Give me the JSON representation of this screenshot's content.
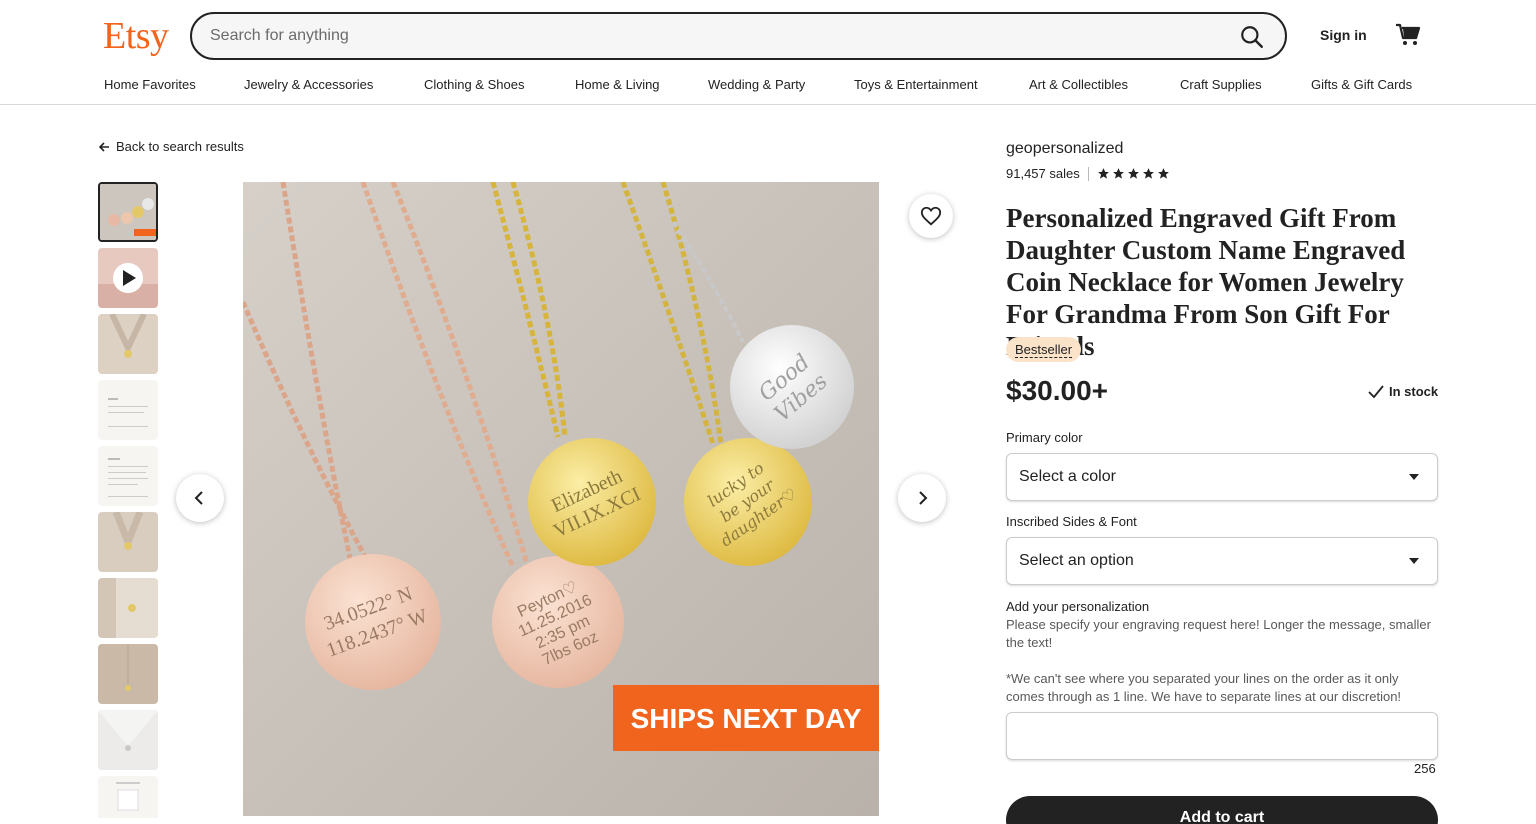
{
  "header": {
    "logo": "Etsy",
    "search_placeholder": "Search for anything",
    "signin": "Sign in"
  },
  "nav": [
    "Home Favorites",
    "Jewelry & Accessories",
    "Clothing & Shoes",
    "Home & Living",
    "Wedding & Party",
    "Toys & Entertainment",
    "Art & Collectibles",
    "Craft Supplies",
    "Gifts & Gift Cards"
  ],
  "back_link": "Back to search results",
  "image_overlay": {
    "banner": "SHIPS NEXT DAY",
    "pendant_texts": [
      "34.0522° N",
      "118.2437° W",
      "Peyton♡",
      "11.25.2016",
      "2:35 pm",
      "7lbs 6oz",
      "Elizabeth",
      "VII.IX.XCI",
      "lucky to",
      "be your",
      "daughter♡",
      "Good",
      "Vibes"
    ]
  },
  "product": {
    "shop_name": "geopersonalized",
    "sales": "91,457 sales",
    "rating_stars": 5,
    "title": "Personalized Engraved Gift From Daughter Custom Name Engraved Coin Necklace for Women Jewelry For Grandma From Son Gift For Friends",
    "badge": "Bestseller",
    "price": "$30.00+",
    "stock": "In stock"
  },
  "options": {
    "color_label": "Primary color",
    "color_value": "Select a color",
    "font_label": "Inscribed Sides & Font",
    "font_value": "Select an option"
  },
  "personalization": {
    "label": "Add your personalization",
    "help1": "Please specify your engraving request here! Longer the message, smaller the text!",
    "help2": "*We can't see where you separated your lines on the order as it only comes through as 1 line. We have to separate lines at our discretion!",
    "counter": "256"
  },
  "add_to_cart": "Add to cart",
  "colors": {
    "brand": "#f1641e",
    "dark": "#222222",
    "badge_bg": "#fbe3c9"
  }
}
